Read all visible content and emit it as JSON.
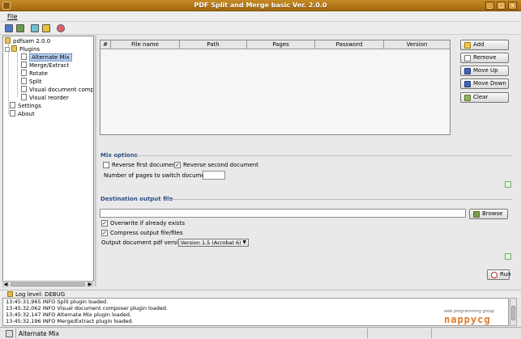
{
  "window": {
    "title": "PDF Split and Merge basic Ver. 2.0.0"
  },
  "menu": {
    "file": "File"
  },
  "tree": {
    "root": "pdfsam 2.0.0",
    "plugins": "Plugins",
    "items": [
      "Alternate Mix",
      "Merge/Extract",
      "Rotate",
      "Split",
      "Visual document compos",
      "Visual reorder"
    ],
    "settings": "Settings",
    "about": "About",
    "selected": "Alternate Mix"
  },
  "table": {
    "columns": [
      "#",
      "File name",
      "Path",
      "Pages",
      "Password",
      "Version"
    ]
  },
  "buttons": {
    "add": "Add",
    "remove": "Remove",
    "move_up": "Move Up",
    "move_down": "Move Down",
    "clear": "Clear",
    "browse": "Browse",
    "run": "Run"
  },
  "mix_options": {
    "title": "Mix options",
    "reverse_first": "Reverse first document",
    "reverse_first_checked": false,
    "reverse_second": "Reverse second document",
    "reverse_second_checked": true,
    "pages_switch_label": "Number of pages to switch document",
    "pages_switch_value": ""
  },
  "destination": {
    "title": "Destination output file",
    "path_value": "",
    "overwrite": "Overwrite if already exists",
    "overwrite_checked": true,
    "compress": "Compress output file/files",
    "compress_checked": true,
    "version_label": "Output document pdf version",
    "version_value": "Version 1.5 (Acrobat 6)"
  },
  "log": {
    "level_label": "Log level: DEBUG",
    "lines": [
      "13:45:31,965 INFO  Split plugin loaded.",
      "13:45:32,062 INFO  Visual document composer plugin loaded.",
      "13:45:32,147 INFO  Alternate Mix plugin loaded.",
      "13:45:32,196 INFO  Merge/Extract plugin loaded."
    ]
  },
  "watermark": {
    "small": "web programming group",
    "big": "nappycg"
  },
  "status": {
    "text": "Alternate Mix"
  },
  "colors": {
    "titlebar": "#b57a1c",
    "section_title": "#2f4f86",
    "selection": "#b5cff0"
  }
}
